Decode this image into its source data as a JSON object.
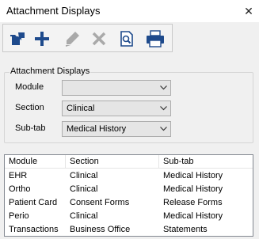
{
  "window": {
    "title": "Attachment Displays",
    "close_glyph": "✕"
  },
  "toolbar": {
    "buttons": [
      {
        "name": "open-folder-icon",
        "enabled": true
      },
      {
        "name": "add-icon",
        "enabled": true
      },
      {
        "name": "edit-icon",
        "enabled": false
      },
      {
        "name": "delete-icon",
        "enabled": false
      },
      {
        "name": "preview-icon",
        "enabled": true
      },
      {
        "name": "print-icon",
        "enabled": true
      }
    ]
  },
  "filter": {
    "legend": "Attachment Displays",
    "module_label": "Module",
    "module_value": "",
    "section_label": "Section",
    "section_value": "Clinical",
    "subtab_label": "Sub-tab",
    "subtab_value": "Medical History"
  },
  "grid": {
    "columns": [
      "Module",
      "Section",
      "Sub-tab"
    ],
    "rows": [
      [
        "EHR",
        "Clinical",
        "Medical History"
      ],
      [
        "Ortho",
        "Clinical",
        "Medical History"
      ],
      [
        "Patient Card",
        "Consent Forms",
        "Release Forms"
      ],
      [
        "Perio",
        "Clinical",
        "Medical History"
      ],
      [
        "Transactions",
        "Business Office",
        "Statements"
      ]
    ]
  },
  "colors": {
    "accent_blue": "#1e4a8c",
    "disabled_gray": "#a9a9a9"
  }
}
